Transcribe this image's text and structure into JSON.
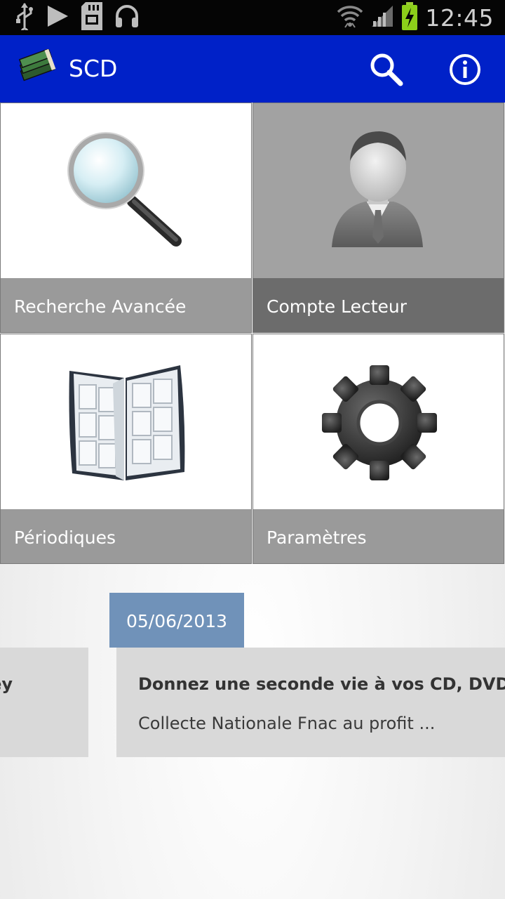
{
  "status_bar": {
    "time": "12:45",
    "left_icons": [
      "usb-icon",
      "play-icon",
      "sd-card-icon",
      "headphones-icon"
    ],
    "right_icons": [
      "wifi-icon",
      "signal-icon",
      "battery-charging-icon"
    ]
  },
  "app_bar": {
    "title": "SCD",
    "logo_icon": "books-icon",
    "actions": [
      "search-icon",
      "info-icon"
    ],
    "color": "#0021c8"
  },
  "tiles": [
    {
      "label": "Recherche Avancée",
      "icon": "magnifier-icon"
    },
    {
      "label": "Compte Lecteur",
      "icon": "user-avatar-icon"
    },
    {
      "label": "Périodiques",
      "icon": "magazine-icon"
    },
    {
      "label": "Paramètres",
      "icon": "gear-icon"
    }
  ],
  "news": {
    "date": "05/06/2013",
    "date_color": "#7092b9",
    "previous_item_title_fragment": "ey",
    "item": {
      "title": "Donnez une seconde vie à vos CD, DVD, L",
      "description": "Collecte Nationale Fnac au profit ..."
    }
  }
}
